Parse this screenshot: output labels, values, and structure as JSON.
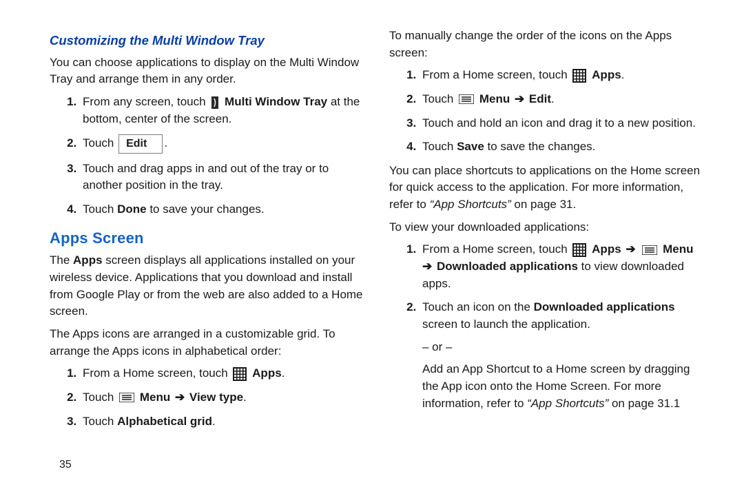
{
  "left": {
    "subhead": "Customizing the Multi Window Tray",
    "intro": "You can choose applications to display on the Multi Window Tray and arrange them in any order.",
    "step1_a": "From any screen, touch ",
    "step1_b": "Multi Window Tray",
    "step1_c": " at the bottom, center of the screen.",
    "step2_a": "Touch ",
    "edit_label": "Edit",
    "step2_c": ".",
    "step3": "Touch and drag apps in and out of the tray or to another position in the tray.",
    "step4_a": "Touch ",
    "step4_b": "Done",
    "step4_c": " to save your changes.",
    "apps_head": "Apps Screen",
    "apps_p1_a": "The ",
    "apps_p1_b": "Apps",
    "apps_p1_c": " screen displays all applications installed on your wireless device. Applications that you download and install from Google Play or from the web are also added to a Home screen.",
    "apps_p2": "The Apps icons are arranged in a customizable grid. To arrange the Apps icons in alphabetical order:",
    "a1_a": "From a Home screen, touch ",
    "a1_b": "Apps",
    "a1_c": ".",
    "a2_a": "Touch ",
    "a2_b": "Menu",
    "a2_arrow": " ➔ ",
    "a2_c": "View type",
    "a2_d": ".",
    "a3_a": "Touch ",
    "a3_b": "Alphabetical grid",
    "a3_c": "."
  },
  "right": {
    "p1": "To manually change the order of the icons on the Apps screen:",
    "b1_a": "From a Home screen, touch ",
    "b1_b": "Apps",
    "b1_c": ".",
    "b2_a": "Touch ",
    "b2_b": "Menu",
    "b2_arrow": " ➔ ",
    "b2_c": "Edit",
    "b2_d": ".",
    "b3": "Touch and hold an icon and drag it to a new position.",
    "b4_a": "Touch ",
    "b4_b": "Save",
    "b4_c": " to save the changes.",
    "p2_a": "You can place shortcuts to applications on the Home screen for quick access to the application. For more information, refer to ",
    "p2_b": "“App Shortcuts”",
    "p2_c": " on page 31.",
    "p3": "To view your downloaded applications:",
    "c1_a": "From a Home screen, touch ",
    "c1_b": "Apps",
    "c1_arrow": " ➔ ",
    "c1_c": "Menu",
    "c1_arrow2": " ➔ ",
    "c1_d": "Downloaded applications",
    "c1_e": " to view downloaded apps.",
    "c2_a": "Touch an icon on the ",
    "c2_b": "Downloaded applications",
    "c2_c": " screen to launch the application.",
    "or": "– or –",
    "c2_d": "Add an App Shortcut to a Home screen by dragging the App icon onto the Home Screen. For more information, refer to ",
    "c2_e": "“App Shortcuts”",
    "c2_f": " on page 31.1"
  },
  "pagenum": "35"
}
